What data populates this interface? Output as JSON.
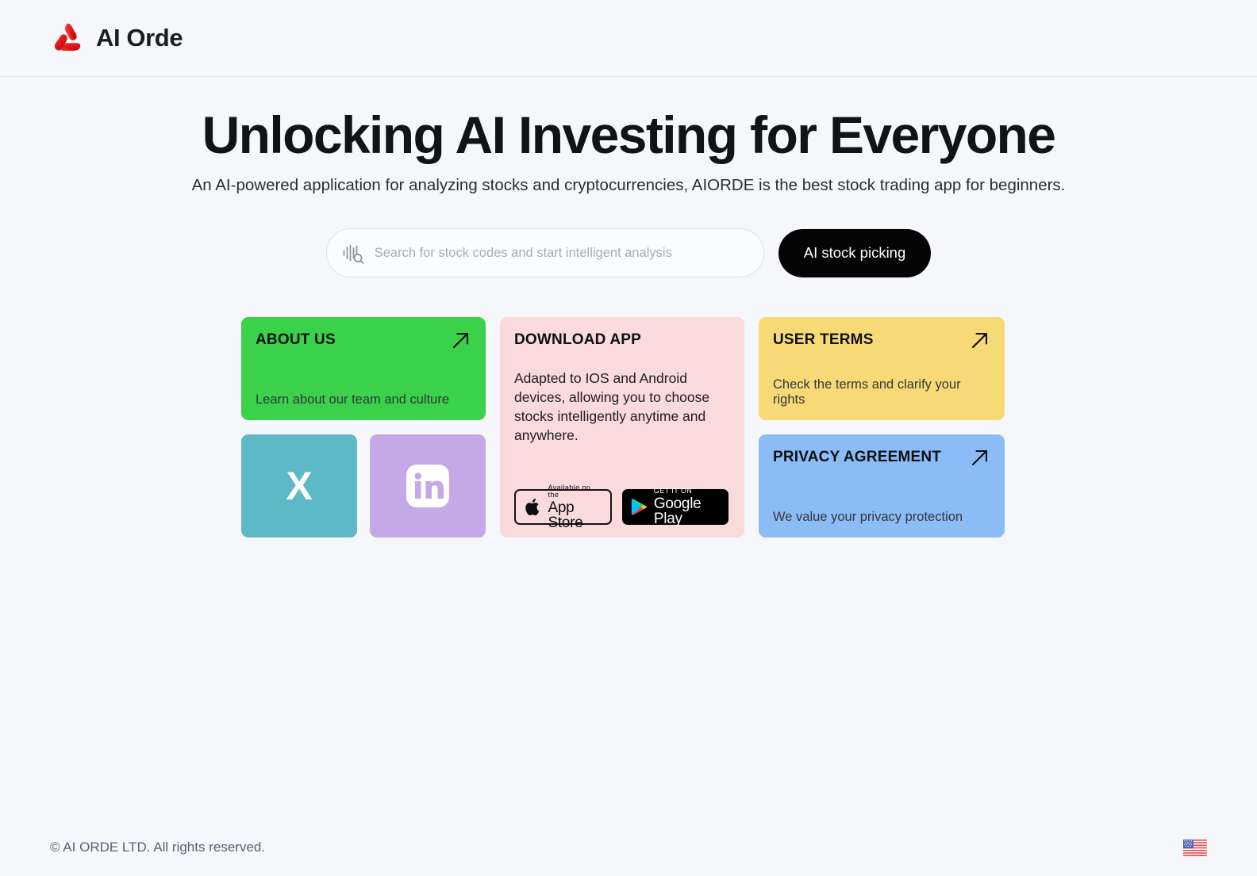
{
  "header": {
    "brand_name": "AI Orde",
    "logo_icon": "aiorde-trefoil-logo",
    "logo_color": "#e01b15"
  },
  "hero": {
    "headline": "Unlocking AI Investing for Everyone",
    "subhead": "An AI-powered application for analyzing stocks and cryptocurrencies, AIORDE is the best stock trading app for beginners."
  },
  "search": {
    "icon": "waveform-search-icon",
    "placeholder": "Search for stock codes and start intelligent analysis",
    "value": "",
    "cta_label": "AI stock picking"
  },
  "cards": {
    "about": {
      "title": "ABOUT US",
      "subtitle": "Learn about our team and culture",
      "color": "#3bd14b",
      "arrow_icon": "arrow-up-right-icon"
    },
    "download": {
      "title": "DOWNLOAD APP",
      "body": "Adapted to IOS and Android devices, allowing you to choose stocks intelligently anytime and anywhere.",
      "color": "#fadada",
      "app_store": {
        "small": "Available on the",
        "big": "App Store",
        "icon": "apple-logo-icon"
      },
      "google_play": {
        "small": "GET IT ON",
        "big": "Google Play",
        "icon": "google-play-icon"
      }
    },
    "terms": {
      "title": "USER TERMS",
      "subtitle": "Check the terms and clarify your rights",
      "color": "#f7da76",
      "arrow_icon": "arrow-up-right-icon"
    },
    "privacy": {
      "title": "PRIVACY AGREEMENT",
      "subtitle": "We value your privacy protection",
      "color": "#8cbcf5",
      "arrow_icon": "arrow-up-right-icon"
    }
  },
  "social": {
    "x": {
      "glyph": "X",
      "icon": "x-twitter-icon",
      "color": "#5cb9c5"
    },
    "linkedin": {
      "icon": "linkedin-icon",
      "color": "#c5a8e8"
    }
  },
  "footer": {
    "copyright": "© AI ORDE LTD. All rights reserved.",
    "language_flag": "us-flag-icon"
  }
}
